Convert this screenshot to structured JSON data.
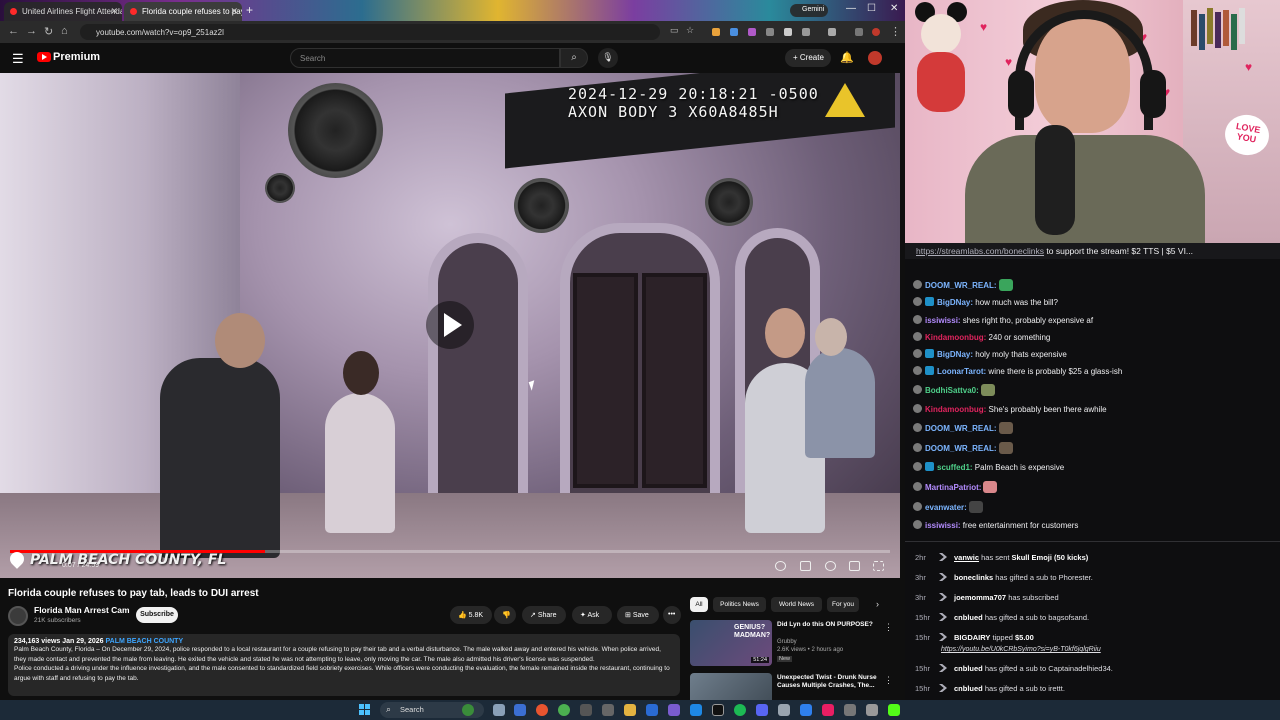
{
  "browser": {
    "tabs": [
      {
        "label": "United Airlines Flight Attendant",
        "active": false
      },
      {
        "label": "Florida couple refuses to pay tab",
        "active": true
      }
    ],
    "gemini_label": "Gemini",
    "url": "youtube.com/watch?v=op9_251az2l"
  },
  "youtube": {
    "brand": "Premium",
    "search_placeholder": "Search",
    "create_label": "Create",
    "video": {
      "timestamp_line1": "2024-12-29 20:18:21 -0500",
      "timestamp_line2": "AXON BODY 3 X60A8485H",
      "location": "PALM BEACH COUNTY, FL",
      "timecode": "0:07 / 24:59",
      "progress": 0.29
    },
    "title": "Florida couple refuses to pay tab, leads to DUI arrest",
    "channel": {
      "name": "Florida Man Arrest Cam",
      "subscribers": "21K subscribers",
      "subscribe_label": "Subscribe"
    },
    "actions": {
      "likes": "5.8K",
      "share": "Share",
      "ask": "Ask",
      "save": "Save"
    },
    "description": {
      "meta": "234,163 views  Jan 29, 2026",
      "tag": "PALM BEACH COUNTY",
      "line1": "Palm Beach County, Florida – On December 29, 2024, police responded to a local restaurant for a couple refusing to pay their tab and a verbal disturbance.  The male walked away and entered his vehicle.  When police arrived, they made contact and prevented the male from leaving. He exited the vehicle and stated he was not attempting to leave, only moving the car. The male also admitted his driver's license was suspended.",
      "line2": "Police conducted a driving under the influence investigation, and the male consented to standardized field sobriety exercises. While officers were conducting the evaluation, the female remained inside the restaurant, continuing to argue with staff and refusing to pay the tab."
    },
    "chips": [
      "All",
      "Politics News",
      "World News",
      "For you"
    ],
    "recommendations": [
      {
        "title": "Did Lyn do this ON PURPOSE?",
        "channel": "Grubby",
        "meta": "2.6K views • 2 hours ago",
        "badge": "New",
        "duration": "51:24",
        "thumb_text": "GENIUS? MADMAN?"
      },
      {
        "title": "Unexpected Twist - Drunk Nurse Causes Multiple Crashes, The...",
        "channel": "",
        "meta": "",
        "badge": "",
        "duration": "",
        "thumb_text": ""
      }
    ]
  },
  "stream": {
    "love_sign": "LOVE YOU"
  },
  "chat": {
    "banner_link": "https://streamlabs.com/boneclinks",
    "banner_text": " to support the stream! $2 TTS | $5 VI...",
    "messages": [
      {
        "user": "DOOM_WR_REAL:",
        "color": "#7cb5ff",
        "text": "",
        "badge2": false,
        "emote": "#3aa55c"
      },
      {
        "user": "BigDNay:",
        "color": "#7cb5ff",
        "text": " how much was the bill?",
        "badge2": true,
        "emote": ""
      },
      {
        "user": "issiwissi:",
        "color": "#b48cff",
        "text": " shes right tho, probably expensive af",
        "badge2": false,
        "emote": ""
      },
      {
        "user": "Kindamoonbug:",
        "color": "#e0245e",
        "text": " 240 or something",
        "badge2": false,
        "emote": ""
      },
      {
        "user": "BigDNay:",
        "color": "#7cb5ff",
        "text": " holy moly thats expensive",
        "badge2": true,
        "emote": ""
      },
      {
        "user": "LoonarTarot:",
        "color": "#7cb5ff",
        "text": " wine there is probably $25 a glass-ish",
        "badge2": true,
        "emote": ""
      },
      {
        "user": "BodhiSattva0:",
        "color": "#4fd08a",
        "text": "",
        "badge2": false,
        "emote": "#7d8c5a"
      },
      {
        "user": "Kindamoonbug:",
        "color": "#e0245e",
        "text": " She's probably been there awhile",
        "badge2": false,
        "emote": ""
      },
      {
        "user": "DOOM_WR_REAL:",
        "color": "#7cb5ff",
        "text": "",
        "badge2": false,
        "emote": "#6a5a4a"
      },
      {
        "user": "DOOM_WR_REAL:",
        "color": "#7cb5ff",
        "text": "",
        "badge2": false,
        "emote": "#6a5a4a"
      },
      {
        "user": "scuffed1:",
        "color": "#4fd08a",
        "text": " Palm Beach is expensive",
        "badge2": true,
        "emote": ""
      },
      {
        "user": "MartinaPatriot:",
        "color": "#b48cff",
        "text": "",
        "badge2": false,
        "emote": "#d9878b"
      },
      {
        "user": "evanwater:",
        "color": "#7cb5ff",
        "text": "",
        "badge2": false,
        "emote": "#444444"
      },
      {
        "user": "issiwissi:",
        "color": "#b48cff",
        "text": " free entertainment for customers",
        "badge2": false,
        "emote": ""
      }
    ],
    "events": [
      {
        "time": "2hr",
        "user": "vanwic",
        "action": " has sent ",
        "highlight": "Skull Emoji (50 kicks)",
        "extra": "",
        "sub": ""
      },
      {
        "time": "3hr",
        "user": "boneclinks",
        "action": " has gifted a sub to ",
        "highlight": "",
        "extra": "Phorester.",
        "sub": ""
      },
      {
        "time": "3hr",
        "user": "joemomma707",
        "action": " has subscribed",
        "highlight": "",
        "extra": "",
        "sub": ""
      },
      {
        "time": "15hr",
        "user": "cnblued",
        "action": " has gifted a sub to ",
        "highlight": "",
        "extra": "bagsofsand.",
        "sub": ""
      },
      {
        "time": "15hr",
        "user": "BIGDAIRY",
        "action": " tipped ",
        "highlight": "$5.00",
        "extra": "",
        "sub": "https://youtu.be/U0kCRbSyimo?si=yB-T0kf6jqlgRiiu"
      },
      {
        "time": "15hr",
        "user": "cnblued",
        "action": " has gifted a sub to ",
        "highlight": "",
        "extra": "Captainadelhied34.",
        "sub": ""
      },
      {
        "time": "15hr",
        "user": "cnblued",
        "action": " has gifted a sub to ",
        "highlight": "",
        "extra": "irettt.",
        "sub": ""
      },
      {
        "time": "15hr",
        "user": "cnblued",
        "action": " has gifted a sub to ",
        "highlight": "",
        "extra": "MF_TWILLIS.",
        "sub": ""
      }
    ]
  },
  "taskbar": {
    "search_placeholder": "Search"
  }
}
